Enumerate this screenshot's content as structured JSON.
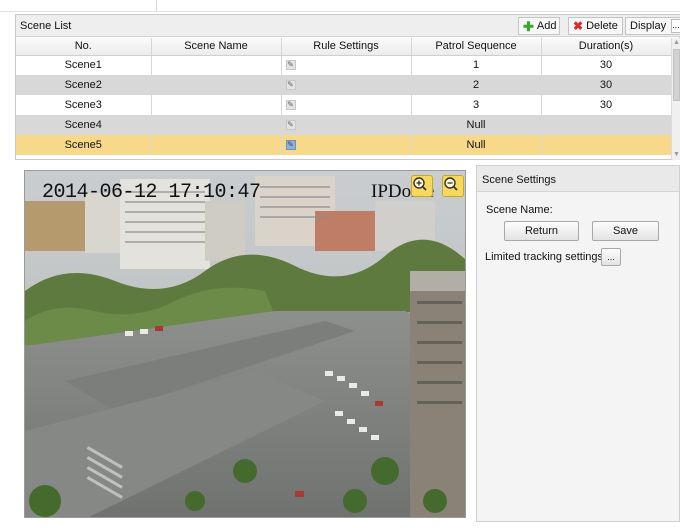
{
  "scene_list": {
    "title": "Scene List",
    "toolbar": {
      "add_label": "Add",
      "delete_label": "Delete",
      "display_label": "Display",
      "more_label": "..."
    },
    "columns": [
      "No.",
      "Scene Name",
      "Rule Settings",
      "Patrol Sequence",
      "Duration(s)"
    ],
    "rows": [
      {
        "no": "Scene1",
        "name": "",
        "patrol": "1",
        "duration": "30"
      },
      {
        "no": "Scene2",
        "name": "",
        "patrol": "2",
        "duration": "30"
      },
      {
        "no": "Scene3",
        "name": "",
        "patrol": "3",
        "duration": "30"
      },
      {
        "no": "Scene4",
        "name": "",
        "patrol": "Null",
        "duration": ""
      },
      {
        "no": "Scene5",
        "name": "",
        "patrol": "Null",
        "duration": ""
      }
    ],
    "selected_row": 4
  },
  "video": {
    "timestamp": "2014-06-12 17:10:47",
    "channel_label": "IPDome"
  },
  "settings": {
    "title": "Scene Settings",
    "scene_name_label": "Scene Name:",
    "return_label": "Return",
    "save_label": "Save",
    "limited_tracking_label": "Limited tracking settings",
    "more_label": "..."
  },
  "colors": {
    "selected_row": "#f8d98a",
    "alt_row": "#d8d8d8",
    "zoom_button": "#f6d95c",
    "add_icon": "#3aa630",
    "delete_icon": "#d82b2b"
  }
}
